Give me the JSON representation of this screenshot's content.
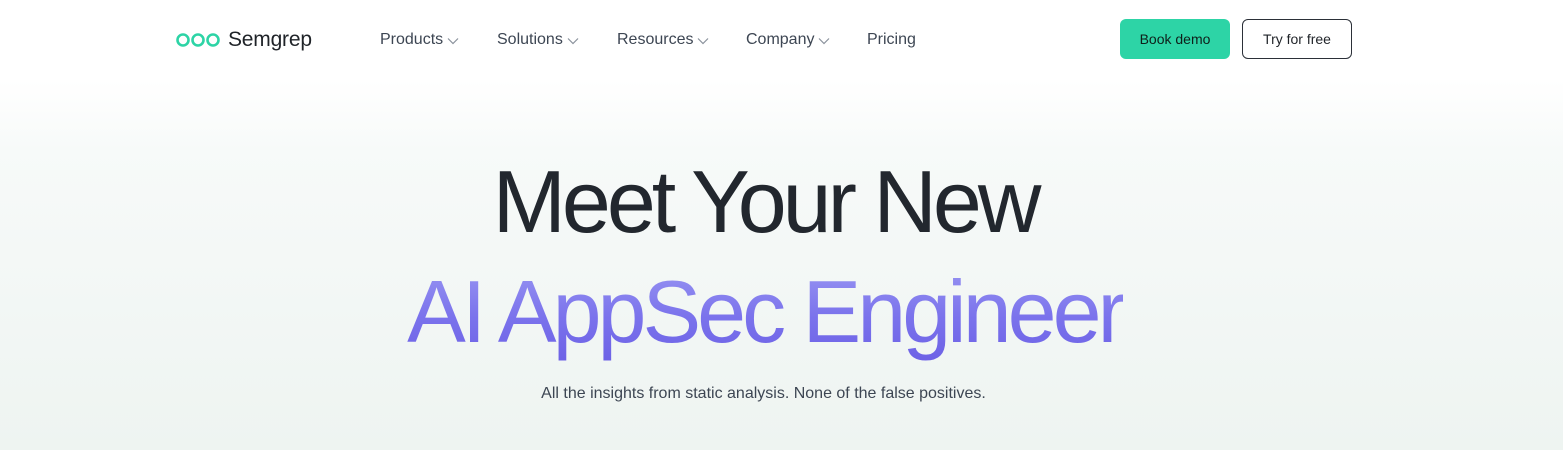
{
  "header": {
    "brand": "Semgrep",
    "nav": [
      {
        "label": "Products",
        "has_dropdown": true
      },
      {
        "label": "Solutions",
        "has_dropdown": true
      },
      {
        "label": "Resources",
        "has_dropdown": true
      },
      {
        "label": "Company",
        "has_dropdown": true
      },
      {
        "label": "Pricing",
        "has_dropdown": false
      }
    ],
    "cta_primary": "Book demo",
    "cta_secondary": "Try for free"
  },
  "hero": {
    "title_line1": "Meet Your New",
    "title_line2": "AI AppSec Engineer",
    "subtitle": "All the insights from static analysis. None of the false positives."
  },
  "colors": {
    "brand_green": "#2dd4a6",
    "headline_dark": "#22272e",
    "headline_accent": "#7b73ec"
  },
  "icons": {
    "logo": "semgrep-logo-icon",
    "dropdown": "chevron-down-icon"
  }
}
